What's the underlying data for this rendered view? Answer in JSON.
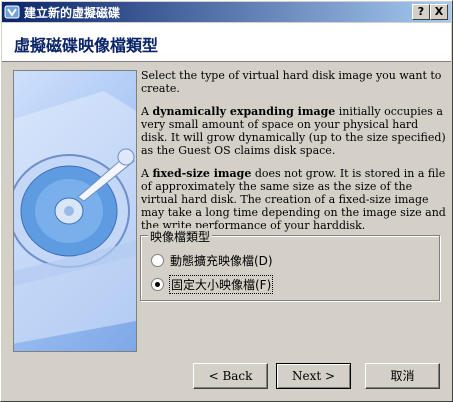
{
  "window": {
    "title": "建立新的虛擬磁碟",
    "help_label": "?",
    "close_label": "X"
  },
  "header": {
    "title": "虛擬磁碟映像檔類型"
  },
  "content": {
    "intro": "Select the type of virtual hard disk image you want to create.",
    "dynamic_lead": "A ",
    "dynamic_term": "dynamically expanding image",
    "dynamic_rest": " initially occupies a very small amount of space on your physical hard disk. It will grow dynamically (up to the size specified) as the Guest OS claims disk space.",
    "fixed_lead": "A ",
    "fixed_term": "fixed-size image",
    "fixed_rest": " does not grow. It is stored in a file of approximately the same size as the size of the virtual hard disk. The creation of a fixed-size image may take a long time depending on the image size and the write performance of your harddisk."
  },
  "image_type": {
    "group_label": "映像檔類型",
    "options": [
      {
        "label": "動態擴充映像檔(D)",
        "selected": false
      },
      {
        "label": "固定大小映像檔(F)",
        "selected": true
      }
    ]
  },
  "buttons": {
    "back": "< Back",
    "next": "Next >",
    "cancel": "取消"
  }
}
